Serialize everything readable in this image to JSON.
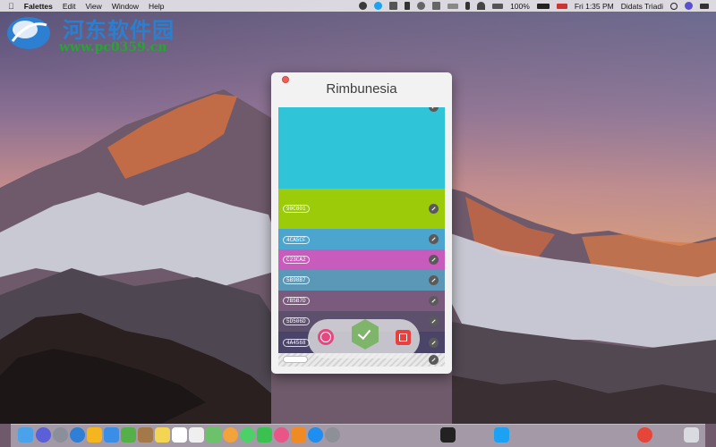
{
  "menubar": {
    "app_name": "Falettes",
    "items": [
      "Edit",
      "View",
      "Window",
      "Help"
    ],
    "battery": "100%",
    "clock": "Fri 1:35 PM",
    "user": "Didats Triadi"
  },
  "watermark": {
    "title": "河东软件园",
    "url": "www.pc0359.cn"
  },
  "window": {
    "title": "Rimbunesia"
  },
  "palette": [
    {
      "hex": "",
      "color": "#2fc4d7"
    },
    {
      "hex": "90C801",
      "color": "#9ccb0a"
    },
    {
      "hex": "4CA5CF",
      "color": "#4ca5cf"
    },
    {
      "hex": "C23CA2",
      "color": "#c85cbc"
    },
    {
      "hex": "5B98B7",
      "color": "#5b98b7"
    },
    {
      "hex": "7B5B7D",
      "color": "#7b5b7d"
    },
    {
      "hex": "5D506D",
      "color": "#5d506d"
    },
    {
      "hex": "4A4568",
      "color": "#4a4568"
    }
  ],
  "dock_icons": [
    "finder-icon",
    "siri-icon",
    "launchpad-icon",
    "safari-icon",
    "sketch-icon",
    "files-icon",
    "leaf-icon",
    "contacts-icon",
    "notes-icon",
    "calendar-icon",
    "reminders-icon",
    "maps-icon",
    "photos-icon",
    "messages-icon",
    "facetime-icon",
    "itunes-icon",
    "ibooks-icon",
    "appstore-icon",
    "system-prefs-icon",
    "terminal-icon",
    "twitter-icon",
    "chrome-icon",
    "trash-icon"
  ]
}
